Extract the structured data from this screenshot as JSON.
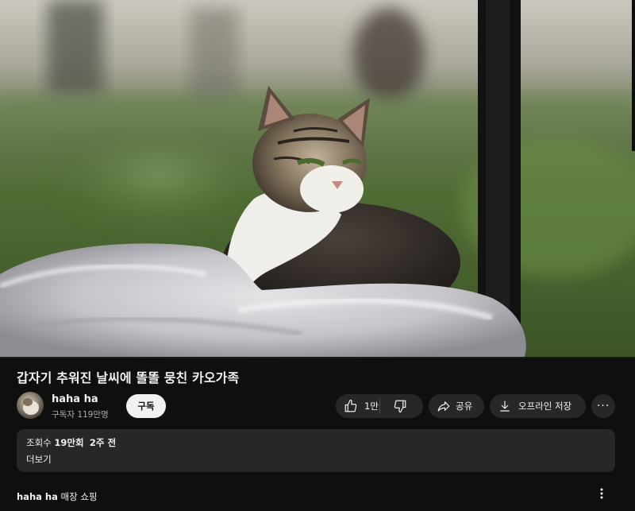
{
  "video": {
    "title": "갑자기 추워진 날씨에 똘똘 뭉친 카오가족"
  },
  "channel": {
    "name": "haha ha",
    "subscribers": "구독자 119만명",
    "subscribe_label": "구독"
  },
  "actions": {
    "like_count": "1만",
    "share_label": "공유",
    "offline_label": "오프라인 저장",
    "more_label": "···"
  },
  "description": {
    "views_prefix": "조회수 ",
    "views_value": "19만회",
    "time_ago": "2주 전",
    "more_label": "더보기"
  },
  "shop": {
    "channel": "haha ha",
    "label": " 매장 쇼핑"
  },
  "icons": {
    "like": "thumbs-up-icon",
    "dislike": "thumbs-down-icon",
    "share": "share-arrow-icon",
    "download": "download-icon",
    "more": "more-horizontal-icon"
  },
  "colors": {
    "background": "#0f0f0f",
    "pill": "#272727",
    "subscribe_bg": "#f1f1f1",
    "secondary_text": "#aaaaaa"
  }
}
